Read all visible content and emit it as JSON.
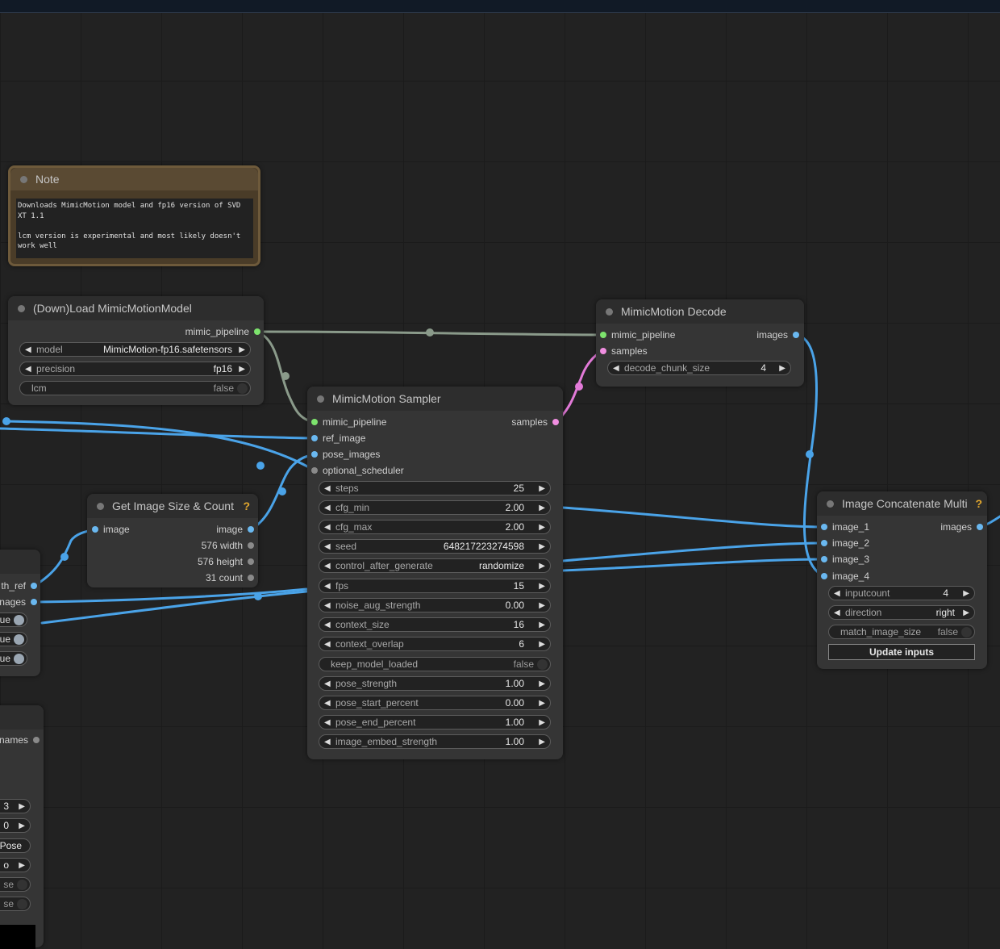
{
  "colors": {
    "link_blue": "#4aa3e8",
    "link_pink": "#e27ad8",
    "link_pipeline": "#8a9a8a",
    "note_header": "#5a4a33",
    "note_border": "#6e5a3b"
  },
  "note": {
    "title": "Note",
    "text": "Downloads MimicMotion model and fp16 version of SVD XT 1.1\n\nlcm version is experimental and most likely doesn't work well"
  },
  "loader": {
    "title": "(Down)Load MimicMotionModel",
    "output": "mimic_pipeline",
    "model_label": "model",
    "model_value": "MimicMotion-fp16.safetensors",
    "precision_label": "precision",
    "precision_value": "fp16",
    "lcm_label": "lcm",
    "lcm_value": "false"
  },
  "decode": {
    "title": "MimicMotion Decode",
    "in1": "mimic_pipeline",
    "in2": "samples",
    "out": "images",
    "chunk_label": "decode_chunk_size",
    "chunk_value": "4"
  },
  "sampler": {
    "title": "MimicMotion Sampler",
    "inputs": [
      "mimic_pipeline",
      "ref_image",
      "pose_images",
      "optional_scheduler"
    ],
    "output": "samples",
    "widgets": [
      {
        "label": "steps",
        "value": "25"
      },
      {
        "label": "cfg_min",
        "value": "2.00"
      },
      {
        "label": "cfg_max",
        "value": "2.00"
      },
      {
        "label": "seed",
        "value": "648217223274598"
      },
      {
        "label": "control_after_generate",
        "value": "randomize"
      },
      {
        "label": "fps",
        "value": "15"
      },
      {
        "label": "noise_aug_strength",
        "value": "0.00"
      },
      {
        "label": "context_size",
        "value": "16"
      },
      {
        "label": "context_overlap",
        "value": "6"
      },
      {
        "label": "keep_model_loaded",
        "value": "false"
      },
      {
        "label": "pose_strength",
        "value": "1.00"
      },
      {
        "label": "pose_start_percent",
        "value": "0.00"
      },
      {
        "label": "pose_end_percent",
        "value": "1.00"
      },
      {
        "label": "image_embed_strength",
        "value": "1.00"
      }
    ]
  },
  "size": {
    "title": "Get Image Size & Count",
    "help": "?",
    "input": "image",
    "out_image": "image",
    "out_width": "576 width",
    "out_height": "576 height",
    "out_count": "31 count"
  },
  "concat": {
    "title": "Image Concatenate Multi",
    "help": "?",
    "inputs": [
      "image_1",
      "image_2",
      "image_3",
      "image_4"
    ],
    "output": "images",
    "inputcount_label": "inputcount",
    "inputcount_value": "4",
    "direction_label": "direction",
    "direction_value": "right",
    "match_label": "match_image_size",
    "match_value": "false",
    "update_button": "Update inputs"
  },
  "left_node_a": {
    "out1": "th_ref",
    "out2": "nages",
    "t1": "ue",
    "t2": "ue",
    "t3": "ue"
  },
  "left_node_b": {
    "out1": "names",
    "w1": "3",
    "w2": "0",
    "w3": "Pose",
    "w4": "o",
    "t1": "se",
    "t2": "se"
  }
}
